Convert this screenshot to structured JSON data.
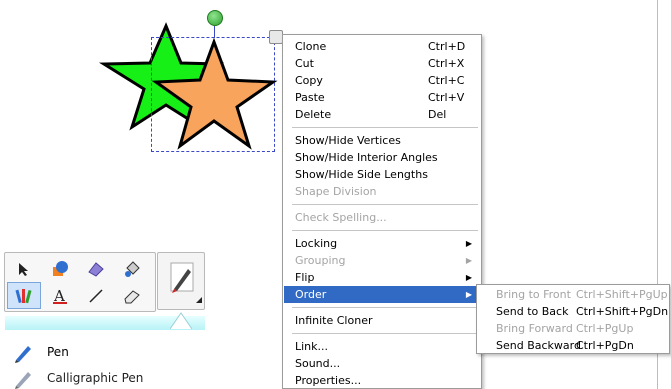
{
  "context_menu": {
    "items": [
      {
        "label": "Clone",
        "shortcut": "Ctrl+D",
        "enabled": true
      },
      {
        "label": "Cut",
        "shortcut": "Ctrl+X",
        "enabled": true
      },
      {
        "label": "Copy",
        "shortcut": "Ctrl+C",
        "enabled": true
      },
      {
        "label": "Paste",
        "shortcut": "Ctrl+V",
        "enabled": true
      },
      {
        "label": "Delete",
        "shortcut": "Del",
        "enabled": true
      },
      {
        "label": "Show/Hide Vertices",
        "enabled": true
      },
      {
        "label": "Show/Hide Interior Angles",
        "enabled": true
      },
      {
        "label": "Show/Hide Side Lengths",
        "enabled": true
      },
      {
        "label": "Shape Division",
        "enabled": false
      },
      {
        "label": "Check Spelling...",
        "enabled": false
      },
      {
        "label": "Locking",
        "enabled": true,
        "submenu": true
      },
      {
        "label": "Grouping",
        "enabled": false,
        "submenu": true
      },
      {
        "label": "Flip",
        "enabled": true,
        "submenu": true
      },
      {
        "label": "Order",
        "enabled": true,
        "submenu": true,
        "highlighted": true
      },
      {
        "label": "Infinite Cloner",
        "enabled": true
      },
      {
        "label": "Link...",
        "enabled": true
      },
      {
        "label": "Sound...",
        "enabled": true
      },
      {
        "label": "Properties...",
        "enabled": true
      }
    ]
  },
  "order_submenu": {
    "items": [
      {
        "label": "Bring to Front",
        "shortcut": "Ctrl+Shift+PgUp",
        "enabled": false
      },
      {
        "label": "Send to Back",
        "shortcut": "Ctrl+Shift+PgDn",
        "enabled": true
      },
      {
        "label": "Bring Forward",
        "shortcut": "Ctrl+PgUp",
        "enabled": false
      },
      {
        "label": "Send Backward",
        "shortcut": "Ctrl+PgDn",
        "enabled": true
      }
    ]
  },
  "canvas": {
    "shapes": [
      {
        "name": "green-star",
        "fill": "#16f016"
      },
      {
        "name": "orange-star",
        "fill": "#f8a45c"
      }
    ],
    "selection_color": "#3b49c8"
  },
  "toolbar": {
    "tools": [
      "select-arrow-icon",
      "shapes-icon",
      "fill-icon",
      "bucket-icon",
      "pens-icon",
      "text-icon",
      "line-icon",
      "eraser-icon"
    ],
    "accent": "#b8f3f7"
  },
  "pen_types": [
    {
      "label": "Pen",
      "icon": "pen-icon"
    },
    {
      "label": "Calligraphic Pen",
      "icon": "calligraphic-pen-icon"
    }
  ]
}
